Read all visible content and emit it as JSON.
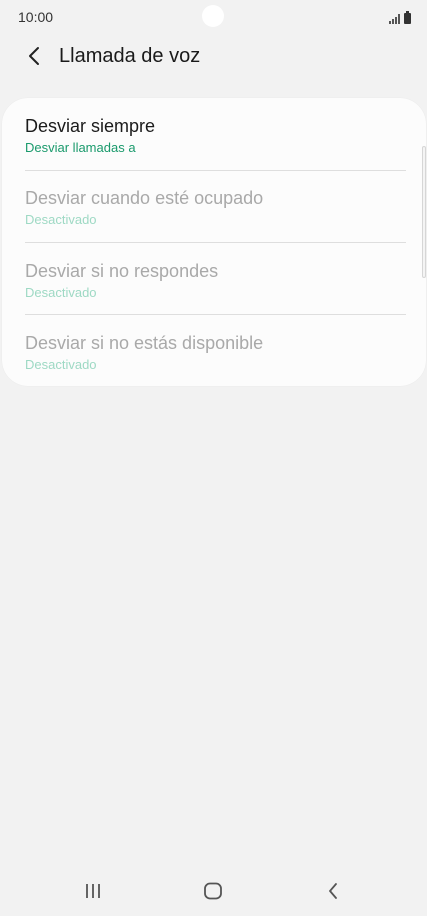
{
  "status_bar": {
    "time": "10:00"
  },
  "app_bar": {
    "back_icon": "chevron-left-icon",
    "title": "Llamada de voz"
  },
  "settings": {
    "items": [
      {
        "title": "Desviar siempre",
        "subtitle": "Desviar llamadas a",
        "enabled": true
      },
      {
        "title": "Desviar cuando esté ocupado",
        "subtitle": "Desactivado",
        "enabled": false
      },
      {
        "title": "Desviar si no respondes",
        "subtitle": "Desactivado",
        "enabled": false
      },
      {
        "title": "Desviar si no estás disponible",
        "subtitle": "Desactivado",
        "enabled": false
      }
    ]
  },
  "nav_bar": {
    "buttons": [
      "recent-apps-icon",
      "home-icon",
      "back-icon"
    ]
  },
  "colors": {
    "background": "#f2f2f2",
    "card": "#fcfcfc",
    "accent_green": "#1a9a6c",
    "disabled_green": "#9ed9c4",
    "disabled_text": "#a9a9a9"
  }
}
